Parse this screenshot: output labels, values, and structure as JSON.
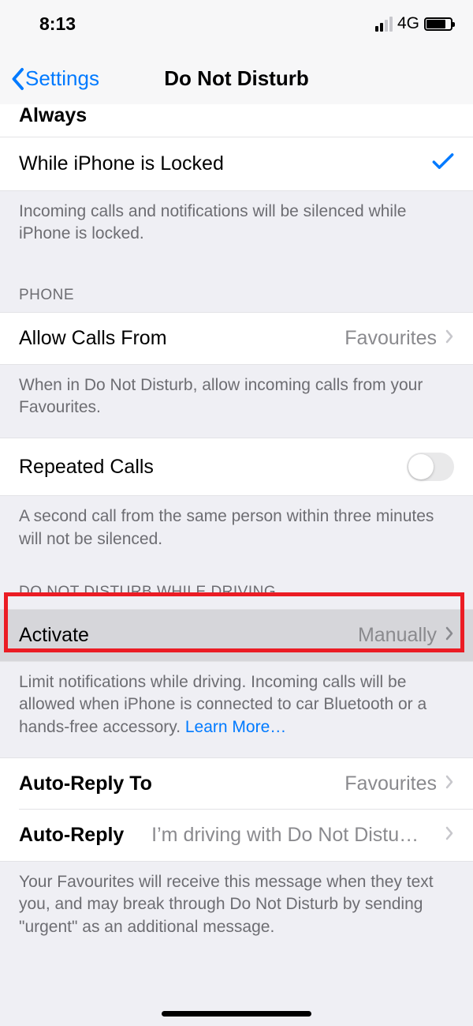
{
  "statusbar": {
    "time": "8:13",
    "network": "4G"
  },
  "nav": {
    "back": "Settings",
    "title": "Do Not Disturb"
  },
  "silence": {
    "always": "Always",
    "while_locked": "While iPhone is Locked",
    "footer": "Incoming calls and notifications will be silenced while iPhone is locked."
  },
  "phone": {
    "header": "PHONE",
    "allow_calls_label": "Allow Calls From",
    "allow_calls_value": "Favourites",
    "allow_calls_footer": "When in Do Not Disturb, allow incoming calls from your Favourites.",
    "repeated_label": "Repeated Calls",
    "repeated_footer": "A second call from the same person within three minutes will not be silenced."
  },
  "driving": {
    "header": "DO NOT DISTURB WHILE DRIVING",
    "activate_label": "Activate",
    "activate_value": "Manually",
    "footer_text": "Limit notifications while driving. Incoming calls will be allowed when iPhone is connected to car Bluetooth or a hands-free accessory. ",
    "learn_more": "Learn More…",
    "auto_reply_to_label": "Auto-Reply To",
    "auto_reply_to_value": "Favourites",
    "auto_reply_label": "Auto-Reply",
    "auto_reply_value": "I’m driving with Do Not Distu…",
    "auto_reply_footer": "Your Favourites will receive this message when they text you, and may break through Do Not Disturb by sending \"urgent\" as an additional message."
  }
}
